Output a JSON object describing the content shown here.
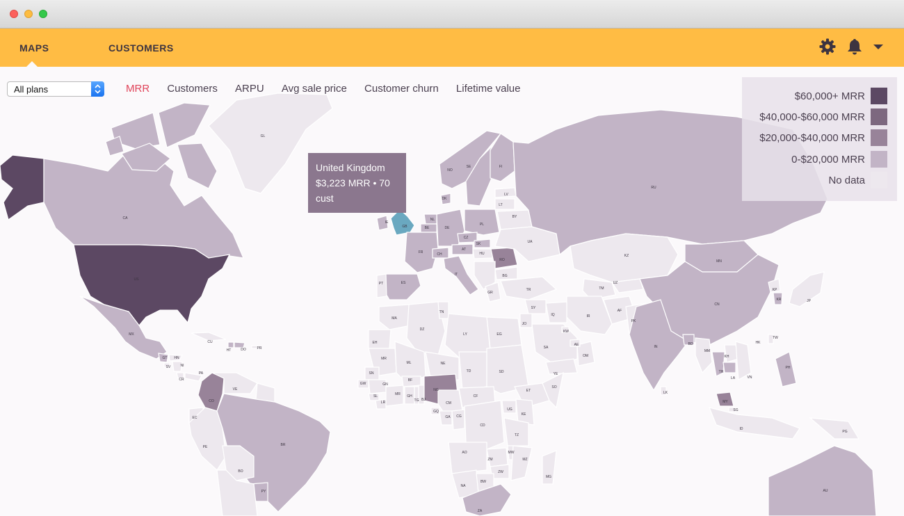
{
  "window": {
    "title": ""
  },
  "nav": {
    "tabs": [
      {
        "label": "MAPS",
        "active": true
      },
      {
        "label": "CUSTOMERS",
        "active": false
      }
    ],
    "icons": [
      "gear-icon",
      "bell-icon",
      "chevron-down-icon"
    ]
  },
  "filters": {
    "plan_select": {
      "value": "All plans"
    },
    "metric_tabs": [
      {
        "label": "MRR",
        "active": true
      },
      {
        "label": "Customers"
      },
      {
        "label": "ARPU"
      },
      {
        "label": "Avg sale price"
      },
      {
        "label": "Customer churn"
      },
      {
        "label": "Lifetime value"
      }
    ]
  },
  "tooltip": {
    "country": "United Kingdom",
    "line1": "$3,223 MRR • 70",
    "line2": "cust"
  },
  "legend": {
    "items": [
      {
        "label": "$60,000+ MRR",
        "color": "#5c4863"
      },
      {
        "label": "$40,000-$60,000 MRR",
        "color": "#7d687f"
      },
      {
        "label": "$20,000-$40,000 MRR",
        "color": "#988399"
      },
      {
        "label": "0-$20,000 MRR",
        "color": "#c2b4c6"
      },
      {
        "label": "No data",
        "color": "#ede8ee"
      }
    ]
  },
  "colors": {
    "header": "#ffbc44",
    "active_metric": "#e0455b",
    "highlight": "#6aa8c0"
  },
  "map": {
    "labels": {
      "gl": "GL",
      "ca": "CA",
      "us": "US",
      "mx": "MX",
      "cu": "CU",
      "ht": "HT",
      "do": "DO",
      "pr": "PR",
      "gt": "GT",
      "hn": "HN",
      "sv": "SV",
      "ni": "NI",
      "cr": "CR",
      "pa": "PA",
      "co": "CO",
      "ve": "VE",
      "ec": "EC",
      "pe": "PE",
      "br": "BR",
      "bo": "BO",
      "py": "PY",
      "gb": "GB",
      "ie": "IE",
      "no": "NO",
      "se": "SE",
      "fi": "FI",
      "dk": "DK",
      "lv": "LV",
      "lt": "LT",
      "by": "BY",
      "pl": "PL",
      "de": "DE",
      "nl": "NL",
      "be": "BE",
      "fr": "FR",
      "ch": "CH",
      "at": "AT",
      "cz": "CZ",
      "sk": "SK",
      "hu": "HU",
      "ro": "RO",
      "ua": "UA",
      "bg": "BG",
      "it": "IT",
      "es": "ES",
      "pt": "PT",
      "gr": "GR",
      "ru": "RU",
      "kz": "KZ",
      "mn": "MN",
      "cn": "CN",
      "tr": "TR",
      "tm": "TM",
      "uz": "UZ",
      "af": "AF",
      "pk": "PK",
      "in": "IN",
      "ir": "IR",
      "iq": "IQ",
      "sy": "SY",
      "jo": "JO",
      "sa": "SA",
      "ye": "YE",
      "om": "OM",
      "ae": "AE",
      "kw": "KW",
      "kp": "KP",
      "kr": "KR",
      "jp": "JP",
      "tw": "TW",
      "hk": "HK",
      "bd": "BD",
      "lk": "LK",
      "mm": "MM",
      "th": "TH",
      "la": "LA",
      "kh": "KH",
      "vn": "VN",
      "my": "MY",
      "sg": "SG",
      "ph": "PH",
      "id": "ID",
      "pg": "PG",
      "au": "AU",
      "ma": "MA",
      "dz": "DZ",
      "tn": "TN",
      "ly": "LY",
      "eg": "EG",
      "eh": "EH",
      "mr": "MR",
      "ml": "ML",
      "ne": "NE",
      "td": "TD",
      "sd": "SD",
      "et": "ET",
      "so": "SO",
      "sn": "SN",
      "gw": "GW",
      "gn": "GN",
      "sl": "SL",
      "lr": "LR",
      "bf": "BF",
      "gh": "GH",
      "tg": "TG",
      "bj": "BJ",
      "ng": "NG",
      "cm": "CM",
      "gq": "GQ",
      "ga": "GA",
      "cg": "CG",
      "cf": "CF",
      "cd": "CD",
      "ug": "UG",
      "ke": "KE",
      "tz": "TZ",
      "ao": "AO",
      "zm": "ZM",
      "mz": "MZ",
      "mw": "MW",
      "zw": "ZW",
      "na": "NA",
      "bw": "BW",
      "za": "ZA",
      "mg": "MG"
    }
  }
}
